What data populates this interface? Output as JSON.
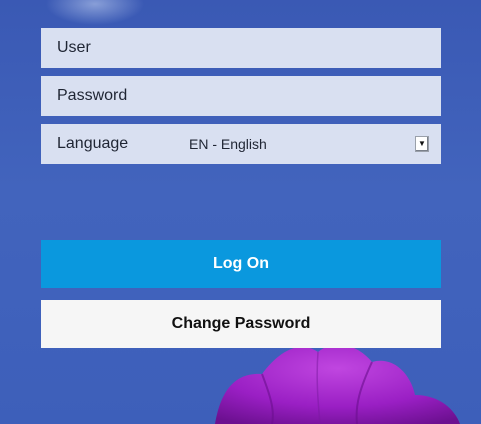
{
  "login_form": {
    "user_placeholder": "User",
    "password_placeholder": "Password",
    "language_label": "Language",
    "language_value": "EN - English",
    "logon_label": "Log On",
    "change_password_label": "Change Password"
  },
  "icons": {
    "select_arrow": "chevron-down-icon"
  },
  "colors": {
    "background": "#3f5fb8",
    "field_background": "#d9e0f1",
    "primary_button": "#0a98de",
    "secondary_button": "#f6f6f6",
    "flower": "#9a1fc4"
  }
}
